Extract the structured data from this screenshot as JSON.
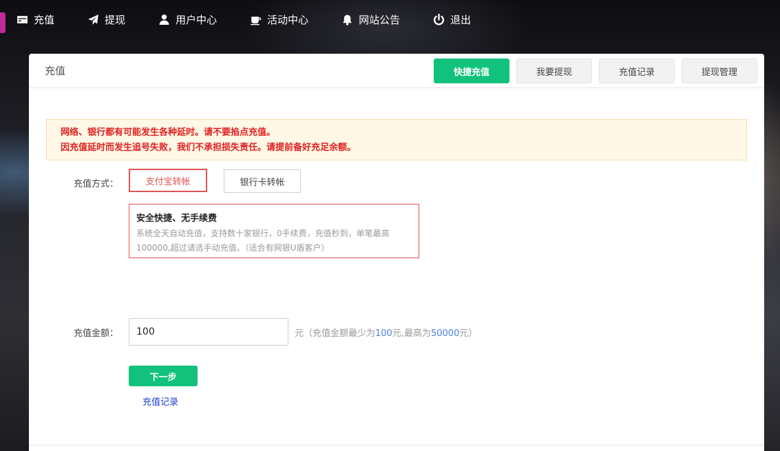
{
  "nav": {
    "items": [
      {
        "label": "充值",
        "icon": "card-icon"
      },
      {
        "label": "提现",
        "icon": "send-icon"
      },
      {
        "label": "用户中心",
        "icon": "user-icon"
      },
      {
        "label": "活动中心",
        "icon": "cup-icon"
      },
      {
        "label": "网站公告",
        "icon": "bell-icon"
      },
      {
        "label": "退出",
        "icon": "power-icon"
      }
    ]
  },
  "panel": {
    "title": "充值",
    "tabs": [
      {
        "label": "快捷充值",
        "active": true
      },
      {
        "label": "我要提现",
        "active": false
      },
      {
        "label": "充值记录",
        "active": false
      },
      {
        "label": "提现管理",
        "active": false
      }
    ]
  },
  "notice": {
    "line1": "网络、银行都有可能发生各种延时。请不要掐点充值。",
    "line2": "因充值延时而发生追号失败，我们不承担损失责任。请提前备好充足余额。"
  },
  "method": {
    "label": "充值方式：",
    "options": [
      {
        "label": "支付宝转帐",
        "selected": true
      },
      {
        "label": "银行卡转帐",
        "selected": false
      }
    ],
    "info_title": "安全快捷、无手续费",
    "info_desc": "系统全天自动充值，支持数十家银行，0手续费，充值秒到，单笔最高100000,超过请选手动充值。（适合有网银U盾客户）"
  },
  "amount": {
    "label": "充值金额：",
    "value": "100",
    "hint_prefix": "元（充值金额最少为",
    "min": "100",
    "hint_mid": "元,最高为",
    "max": "50000",
    "hint_suffix": "元）"
  },
  "actions": {
    "next_label": "下一步",
    "record_link": "充值记录"
  },
  "colors": {
    "accent": "#12c27c",
    "alert": "#e02020",
    "selected_border": "#e05454",
    "link": "#1a3fd0"
  }
}
